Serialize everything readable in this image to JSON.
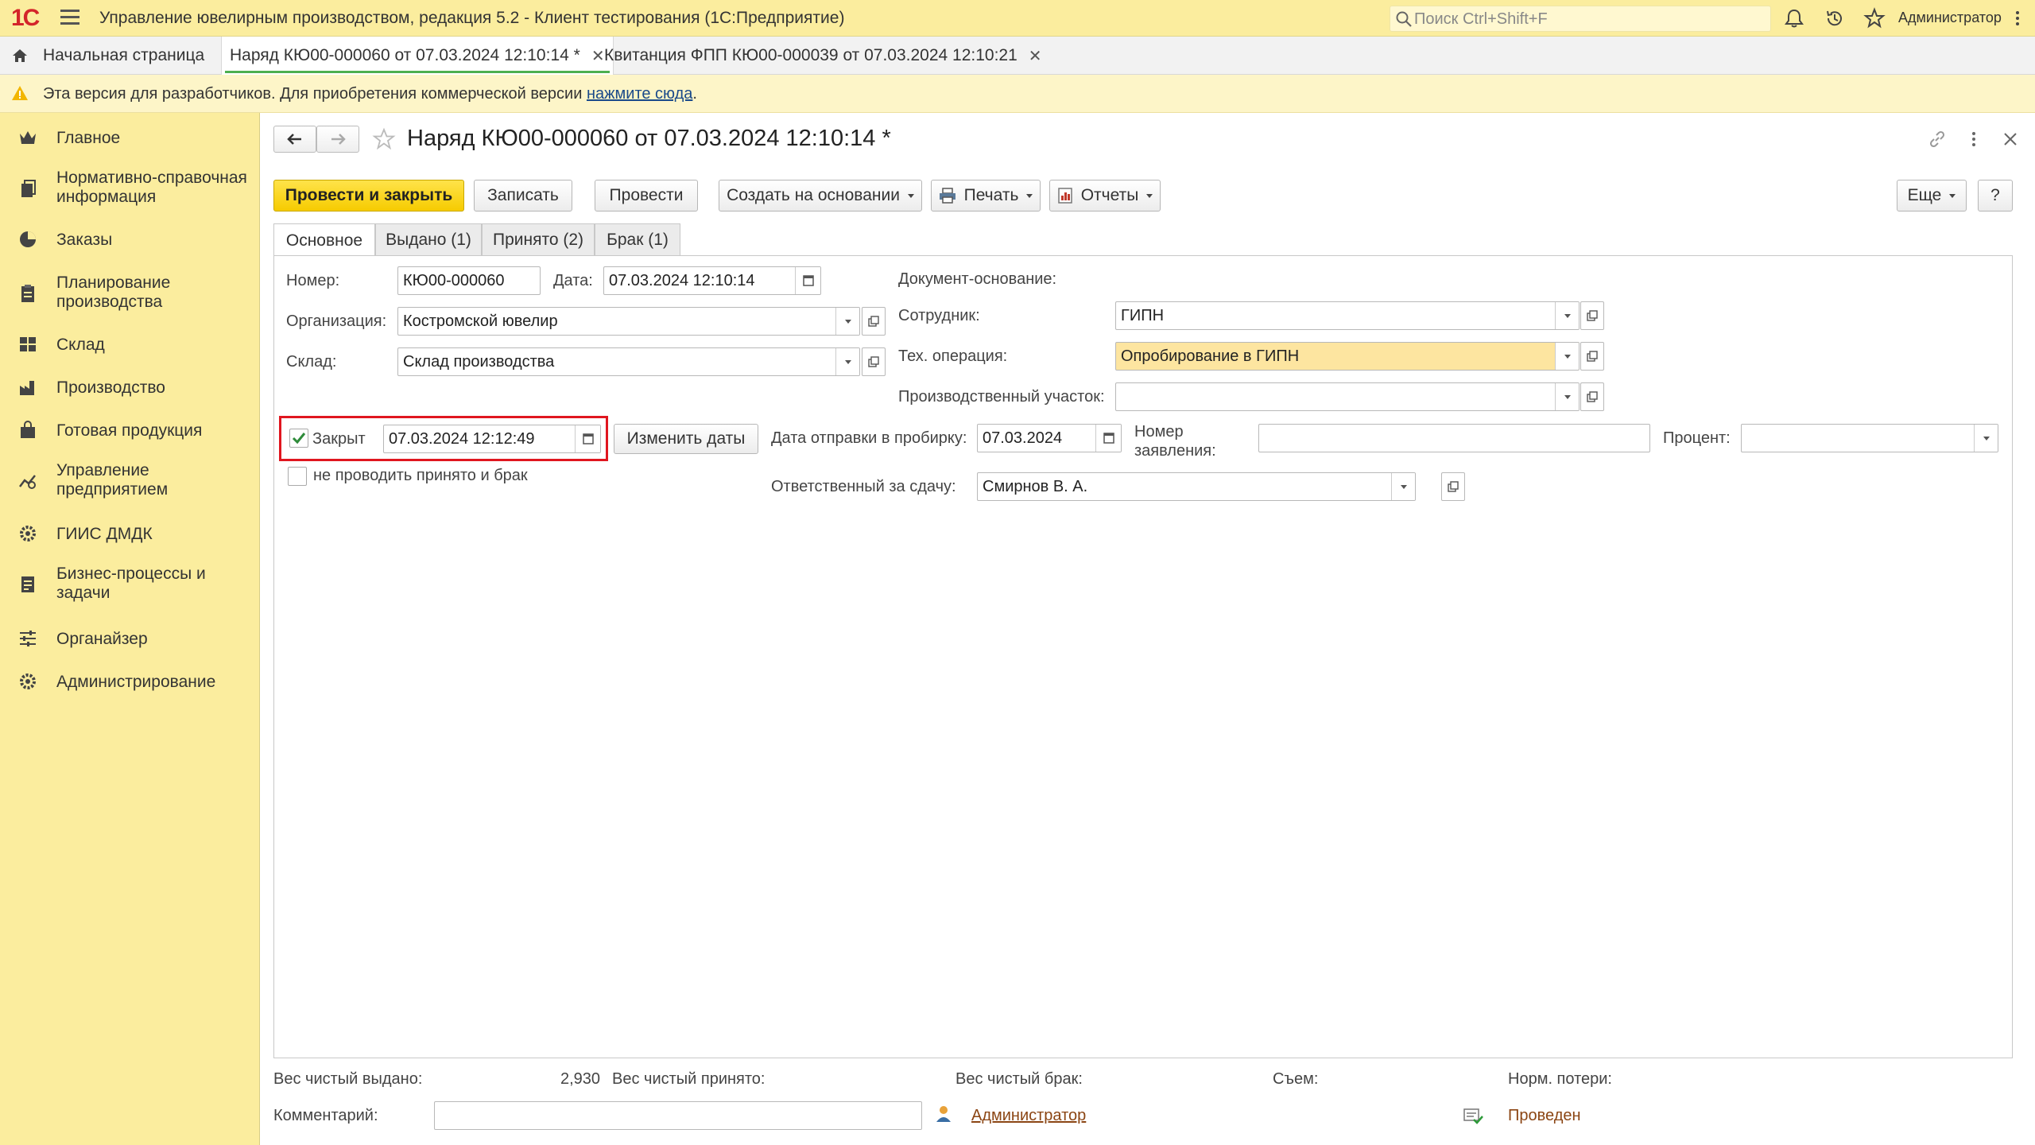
{
  "app": {
    "logo": "1С",
    "title": "Управление ювелирным производством, редакция 5.2  - Клиент тестирования (1С:Предприятие)",
    "search_placeholder": "Поиск Ctrl+Shift+F",
    "user": "Администратор"
  },
  "tabs": {
    "home": "Начальная страница",
    "items": [
      {
        "label": "Наряд КЮ00-000060 от 07.03.2024 12:10:14 *",
        "active": true
      },
      {
        "label": "Квитанция ФПП КЮ00-000039 от 07.03.2024 12:10:21",
        "active": false
      }
    ]
  },
  "notice": {
    "text": "Эта версия для разработчиков. Для приобретения коммерческой версии ",
    "link": "нажмите сюда",
    "tail": "."
  },
  "sidebar": {
    "items": [
      {
        "label": "Главное",
        "icon": "crown-icon"
      },
      {
        "label": "Нормативно-справочная информация",
        "icon": "books-icon"
      },
      {
        "label": "Заказы",
        "icon": "pie-icon"
      },
      {
        "label": "Планирование производства",
        "icon": "clipboard-icon"
      },
      {
        "label": "Склад",
        "icon": "grid-icon"
      },
      {
        "label": "Производство",
        "icon": "factory-icon"
      },
      {
        "label": "Готовая продукция",
        "icon": "bag-icon"
      },
      {
        "label": "Управление предприятием",
        "icon": "chart-gear-icon"
      },
      {
        "label": "ГИИС ДМДК",
        "icon": "gear-icon"
      },
      {
        "label": "Бизнес-процессы и задачи",
        "icon": "document-list-icon"
      },
      {
        "label": "Органайзер",
        "icon": "sliders-icon"
      },
      {
        "label": "Администрирование",
        "icon": "gear-icon"
      }
    ]
  },
  "document": {
    "title": "Наряд КЮ00-000060 от 07.03.2024 12:10:14 *",
    "toolbar": {
      "post_close": "Провести и закрыть",
      "save": "Записать",
      "post": "Провести",
      "create_based": "Создать на основании",
      "print": "Печать",
      "reports": "Отчеты",
      "more": "Еще",
      "help": "?"
    },
    "form_tabs": [
      "Основное",
      "Выдано (1)",
      "Принято (2)",
      "Брак (1)"
    ],
    "fields": {
      "number_label": "Номер:",
      "number": "КЮ00-000060",
      "date_label": "Дата:",
      "date": "07.03.2024 12:10:14",
      "org_label": "Организация:",
      "org": "Костромской ювелир",
      "warehouse_label": "Склад:",
      "warehouse": "Склад производства",
      "base_doc_label": "Документ-основание:",
      "employee_label": "Сотрудник:",
      "employee": "ГИПН",
      "tech_op_label": "Тех. операция:",
      "tech_op": "Опробирование в ГИПН",
      "section_label": "Производственный участок:",
      "section": "",
      "closed_label": "Закрыт",
      "closed_checked": true,
      "closed_date": "07.03.2024 12:12:49",
      "change_dates": "Изменить даты",
      "no_post_label": "не проводить принято и брак",
      "no_post_checked": false,
      "send_date_label": "Дата отправки в пробирку:",
      "send_date": "07.03.2024",
      "app_number_label": "Номер заявления:",
      "app_number": "",
      "percent_label": "Процент:",
      "percent": "",
      "responsible_label": "Ответственный за сдачу:",
      "responsible": "Смирнов В. А."
    },
    "footer": {
      "net_issued_label": "Вес чистый выдано:",
      "net_issued": "2,930",
      "net_received_label": "Вес чистый принято:",
      "net_defect_label": "Вес чистый брак:",
      "removal_label": "Съем:",
      "norm_loss_label": "Норм. потери:",
      "comment_label": "Комментарий:",
      "comment": "",
      "author": "Администратор",
      "status": "Проведен"
    }
  },
  "colors": {
    "header_bg": "#fbed9e",
    "primary_button": "#f6cb00",
    "highlight_field": "#fde5a0",
    "active_tab_underline": "#4caf50",
    "red_frame": "#e0161f",
    "link": "#8b4513"
  }
}
